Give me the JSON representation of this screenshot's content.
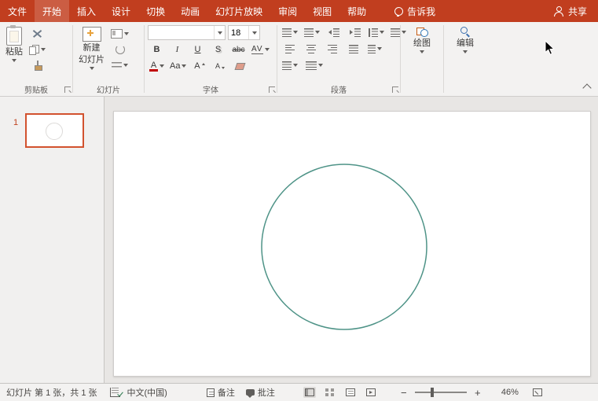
{
  "colors": {
    "accent": "#C13E1F",
    "circle_stroke": "#4E9387",
    "thumb_border": "#D2522E"
  },
  "menubar": {
    "tabs": [
      {
        "label": "文件"
      },
      {
        "label": "开始",
        "active": true
      },
      {
        "label": "插入"
      },
      {
        "label": "设计"
      },
      {
        "label": "切换"
      },
      {
        "label": "动画"
      },
      {
        "label": "幻灯片放映"
      },
      {
        "label": "审阅"
      },
      {
        "label": "视图"
      },
      {
        "label": "帮助"
      }
    ],
    "tell_me": "告诉我",
    "share": "共享"
  },
  "ribbon": {
    "clipboard": {
      "paste": "粘贴",
      "group_label": "剪贴板"
    },
    "slides": {
      "new_slide_line1": "新建",
      "new_slide_line2": "幻灯片",
      "group_label": "幻灯片"
    },
    "font": {
      "font_name": "",
      "font_size": "18",
      "bold": "B",
      "italic": "I",
      "underline": "U",
      "shadow": "S",
      "strikethrough": "abc",
      "char_spacing": "AV",
      "font_color": "A",
      "change_case": "Aa",
      "grow_font": "A",
      "shrink_font": "A",
      "group_label": "字体"
    },
    "paragraph": {
      "group_label": "段落"
    },
    "drawing": {
      "label": "绘图"
    },
    "editing": {
      "label": "编辑"
    }
  },
  "slides_panel": {
    "slide_number": "1"
  },
  "statusbar": {
    "slide_info": "幻灯片 第 1 张，共 1 张",
    "language": "中文(中国)",
    "notes": "备注",
    "comments": "批注",
    "zoom_out": "−",
    "zoom_in": "+",
    "zoom": "46%"
  },
  "icons": {
    "dropdown": "caret-down",
    "lightbulb": "tell-me-bulb",
    "person": "share-person",
    "search": "magnifier"
  }
}
